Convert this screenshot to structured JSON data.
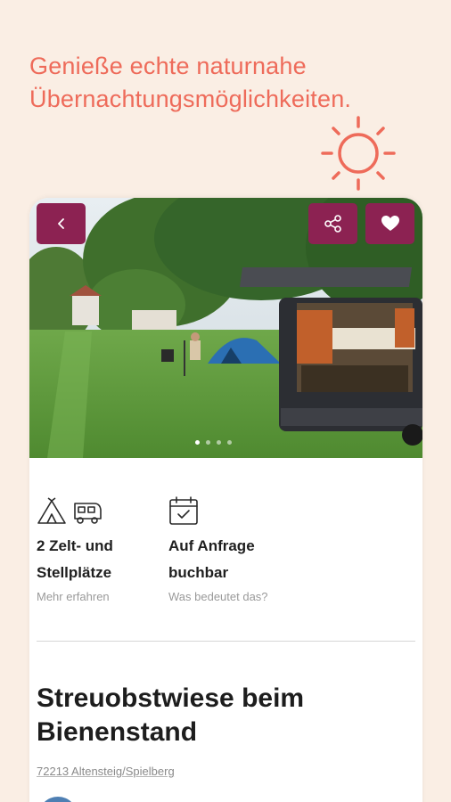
{
  "headline": {
    "line1": "Genieße echte naturnahe",
    "line2": "Übernachtungsmöglichkeiten."
  },
  "colors": {
    "background": "#FAEEE4",
    "accent": "#EE6B5A",
    "brand": "#8C2252"
  },
  "icons": {
    "sun": "sun-icon",
    "back": "chevron-left-icon",
    "share": "share-icon",
    "favorite": "heart-icon",
    "tent": "tent-icon",
    "camper": "camper-van-icon",
    "calendar": "calendar-check-icon"
  },
  "gallery": {
    "image_count": 4,
    "active_index": 0
  },
  "features": [
    {
      "title": "2 Zelt- und Stellplätze",
      "link": "Mehr erfahren"
    },
    {
      "title": "Auf Anfrage buchbar",
      "link": "Was bedeutet das?"
    }
  ],
  "listing": {
    "title": "Streuobstwiese beim Bienenstand",
    "address": "72213 Altensteig/Spielberg"
  }
}
